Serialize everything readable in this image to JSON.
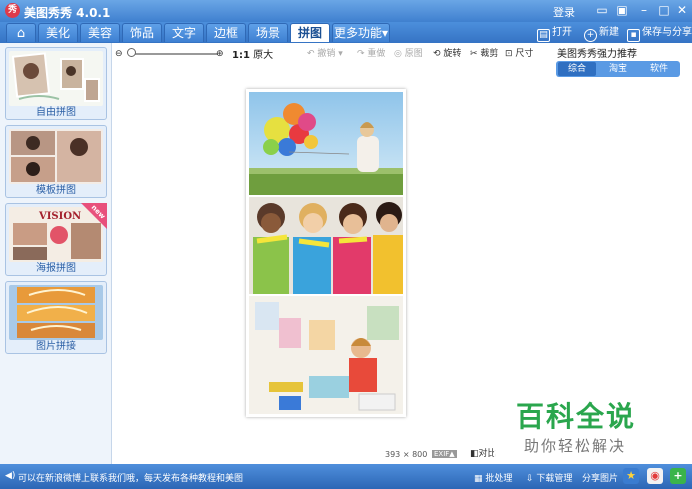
{
  "app": {
    "title": "美图秀秀 4.0.1",
    "logo": "秀",
    "login": "登录"
  },
  "window_buttons": [
    "feedback",
    "skin",
    "minimize",
    "maximize",
    "close"
  ],
  "tabs": [
    {
      "label": "⌂",
      "icon": "home-icon"
    },
    {
      "label": "美化"
    },
    {
      "label": "美容"
    },
    {
      "label": "饰品"
    },
    {
      "label": "文字"
    },
    {
      "label": "边框"
    },
    {
      "label": "场景"
    },
    {
      "label": "拼图",
      "active": true
    },
    {
      "label": "更多功能▾"
    }
  ],
  "toolbar": {
    "open": "打开",
    "new": "新建",
    "save": "保存与分享"
  },
  "left_panel": [
    {
      "label": "自由拼图"
    },
    {
      "label": "模板拼图"
    },
    {
      "label": "海报拼图",
      "badge": "new"
    },
    {
      "label": "图片拼接"
    }
  ],
  "poster_text": "VISION",
  "edit_tools": {
    "zoom_ratio": "1:1",
    "original_size": "原大",
    "undo": "撤销",
    "redo": "重做",
    "original": "原图",
    "rotate": "旋转",
    "crop": "裁剪",
    "resize": "尺寸"
  },
  "canvas": {
    "width": "393",
    "height": "800",
    "exif": "EXIF▲",
    "compare": "对比"
  },
  "right_panel": {
    "title": "美图秀秀强力推荐",
    "tabs": [
      "综合",
      "淘宝",
      "软件"
    ],
    "active_tab": "综合"
  },
  "watermark": {
    "big": "百科全说",
    "small": "助你轻松解决"
  },
  "statusbar": {
    "message": "可以在新浪微博上联系我们哦，每天发布各种教程和美图",
    "batch": "批处理",
    "download": "下载管理",
    "share": "分享图片"
  }
}
